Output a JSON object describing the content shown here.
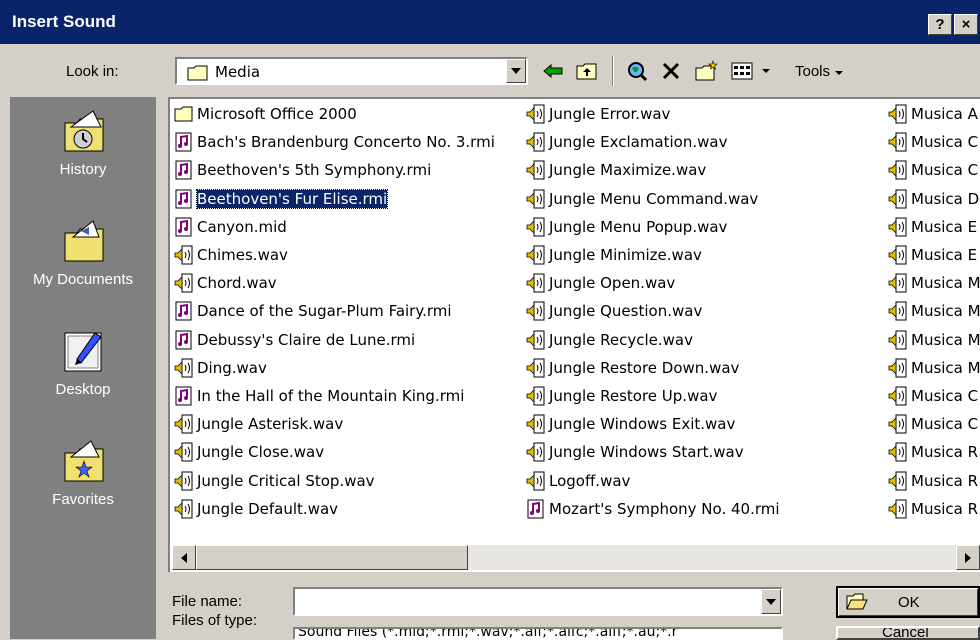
{
  "window": {
    "title": "Insert Sound",
    "help_label": "?",
    "close_label": "×"
  },
  "look_in": {
    "label": "Look in:",
    "value": "Media"
  },
  "toolbar": {
    "tools_label": "Tools"
  },
  "places": [
    {
      "label": "History",
      "icon": "history-icon"
    },
    {
      "label": "My Documents",
      "icon": "my-documents-icon"
    },
    {
      "label": "Desktop",
      "icon": "desktop-icon"
    },
    {
      "label": "Favorites",
      "icon": "favorites-icon"
    }
  ],
  "files": {
    "col1": [
      {
        "name": "Microsoft Office 2000",
        "type": "folder"
      },
      {
        "name": "Bach's Brandenburg Concerto No. 3.rmi",
        "type": "midi"
      },
      {
        "name": "Beethoven's 5th Symphony.rmi",
        "type": "midi"
      },
      {
        "name": "Beethoven's Fur Elise.rmi",
        "type": "midi",
        "selected": true
      },
      {
        "name": "Canyon.mid",
        "type": "midi"
      },
      {
        "name": "Chimes.wav",
        "type": "wav"
      },
      {
        "name": "Chord.wav",
        "type": "wav"
      },
      {
        "name": "Dance of the Sugar-Plum Fairy.rmi",
        "type": "midi"
      },
      {
        "name": "Debussy's Claire de Lune.rmi",
        "type": "midi"
      },
      {
        "name": "Ding.wav",
        "type": "wav"
      },
      {
        "name": "In the Hall of the Mountain King.rmi",
        "type": "midi"
      },
      {
        "name": "Jungle Asterisk.wav",
        "type": "wav"
      },
      {
        "name": "Jungle Close.wav",
        "type": "wav"
      },
      {
        "name": "Jungle Critical Stop.wav",
        "type": "wav"
      },
      {
        "name": "Jungle Default.wav",
        "type": "wav"
      }
    ],
    "col2": [
      {
        "name": "Jungle Error.wav",
        "type": "wav"
      },
      {
        "name": "Jungle Exclamation.wav",
        "type": "wav"
      },
      {
        "name": "Jungle Maximize.wav",
        "type": "wav"
      },
      {
        "name": "Jungle Menu Command.wav",
        "type": "wav"
      },
      {
        "name": "Jungle Menu Popup.wav",
        "type": "wav"
      },
      {
        "name": "Jungle Minimize.wav",
        "type": "wav"
      },
      {
        "name": "Jungle Open.wav",
        "type": "wav"
      },
      {
        "name": "Jungle Question.wav",
        "type": "wav"
      },
      {
        "name": "Jungle Recycle.wav",
        "type": "wav"
      },
      {
        "name": "Jungle Restore Down.wav",
        "type": "wav"
      },
      {
        "name": "Jungle Restore Up.wav",
        "type": "wav"
      },
      {
        "name": "Jungle Windows Exit.wav",
        "type": "wav"
      },
      {
        "name": "Jungle Windows Start.wav",
        "type": "wav"
      },
      {
        "name": "Logoff.wav",
        "type": "wav"
      },
      {
        "name": "Mozart's Symphony No. 40.rmi",
        "type": "midi"
      }
    ],
    "col3": [
      {
        "name": "Musica A",
        "type": "wav"
      },
      {
        "name": "Musica C",
        "type": "wav"
      },
      {
        "name": "Musica C",
        "type": "wav"
      },
      {
        "name": "Musica D",
        "type": "wav"
      },
      {
        "name": "Musica E",
        "type": "wav"
      },
      {
        "name": "Musica E",
        "type": "wav"
      },
      {
        "name": "Musica M",
        "type": "wav"
      },
      {
        "name": "Musica M",
        "type": "wav"
      },
      {
        "name": "Musica M",
        "type": "wav"
      },
      {
        "name": "Musica M",
        "type": "wav"
      },
      {
        "name": "Musica C",
        "type": "wav"
      },
      {
        "name": "Musica C",
        "type": "wav"
      },
      {
        "name": "Musica R",
        "type": "wav"
      },
      {
        "name": "Musica R",
        "type": "wav"
      },
      {
        "name": "Musica R",
        "type": "wav"
      }
    ]
  },
  "file_name": {
    "label": "File name:",
    "value": ""
  },
  "file_type": {
    "label": "Files of type:",
    "value": "Sound Files (*.mid;*.rmi;*.wav;*.aif;*.aifc;*.aiff;*.au;*.r"
  },
  "buttons": {
    "ok": "OK",
    "cancel": "Cancel"
  },
  "colors": {
    "title_bar": "#0a246a",
    "face": "#d4d0c8",
    "places_bg": "#808080",
    "selection": "#0a246a"
  }
}
